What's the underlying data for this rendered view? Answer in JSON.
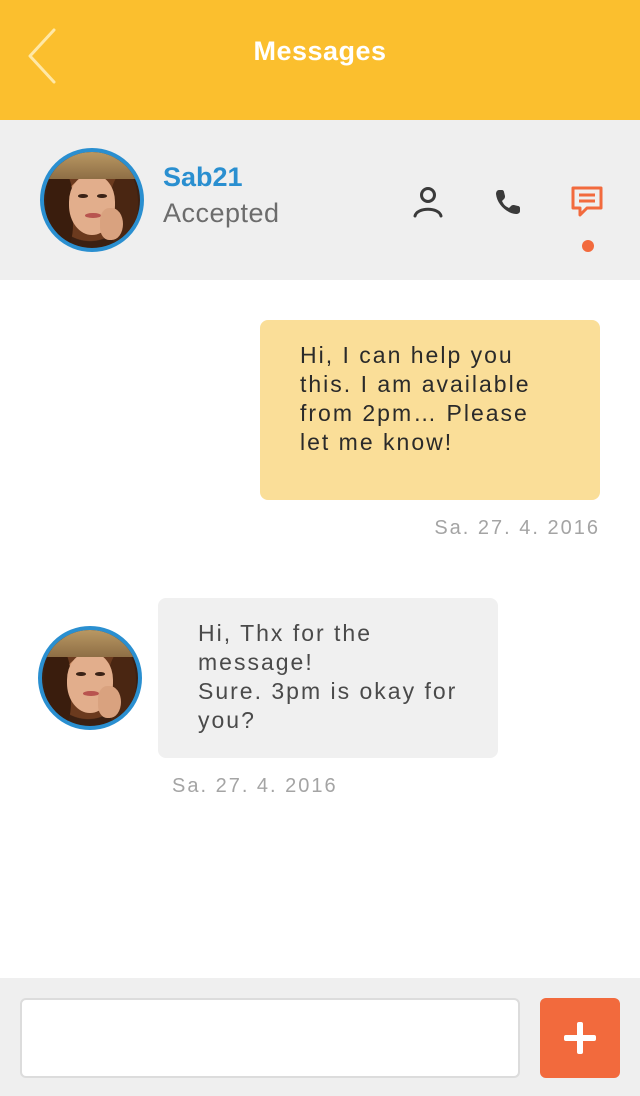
{
  "header": {
    "title": "Messages",
    "back_icon": "chevron-left-icon"
  },
  "contact": {
    "name": "Sab21",
    "status": "Accepted",
    "actions": [
      {
        "icon": "profile-icon"
      },
      {
        "icon": "phone-icon"
      },
      {
        "icon": "chat-icon",
        "active": true
      }
    ]
  },
  "messages": [
    {
      "direction": "outgoing",
      "text": "Hi, I can help you this. I am available from 2pm… Please let me know!",
      "date": "Sa. 27. 4. 2016"
    },
    {
      "direction": "incoming",
      "text": "Hi, Thx for the message!\nSure. 3pm is okay for you?",
      "date": "Sa. 27. 4. 2016"
    }
  ],
  "composer": {
    "placeholder": "",
    "add_icon": "plus-icon"
  },
  "colors": {
    "header": "#FBBF2E",
    "accent_blue": "#2A8FD0",
    "accent_orange": "#F26A3D",
    "outgoing_bubble": "#FADE98",
    "incoming_bubble": "#F0F0F0"
  }
}
